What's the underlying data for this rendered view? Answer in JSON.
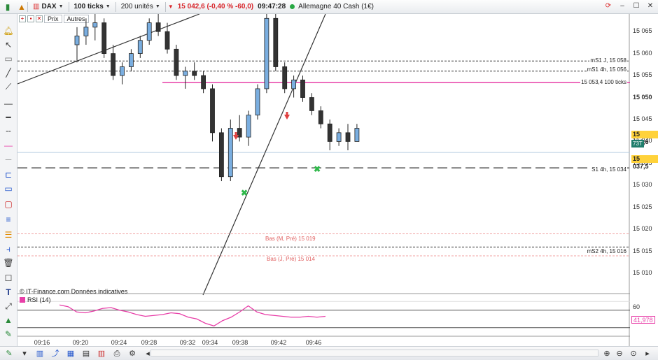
{
  "toolbar": {
    "symbol": "DAX",
    "ticks": "100 ticks",
    "units": "200 unités",
    "price_change": "15 042,6 (-0,40 % -60,0)",
    "time": "09:47:28",
    "instrument": "Allemagne 40 Cash (1€)",
    "colors": {
      "negative": "#d8262b",
      "live": "#27a843"
    }
  },
  "subbar": {
    "prix": "Prix",
    "autres": "Autres"
  },
  "price_axis": {
    "labels": [
      "15 065",
      "15 060",
      "15 055",
      "15 050",
      "15 045",
      "15 040",
      "15 035",
      "15 030",
      "15 025",
      "15 020",
      "15 015",
      "15 010"
    ],
    "current_price": "15 042,6",
    "ticks_left": "73T",
    "crosshair": "15 037,5"
  },
  "levels": {
    "ms1_j": "mS1 J, 15 058",
    "ms1_4h": "mS1 4h, 15 056",
    "ticks100": "15 053,4 100 ticks",
    "s1_4h": "S1 4h, 15 034",
    "bas_m": "Bas (M, Pré) 15 019",
    "bas_j": "Bas (J, Pré) 15 014",
    "ms2_4h": "mS2 4h, 15 016"
  },
  "footer_note": "© IT-Finance.com  Données indicatives",
  "rsi": {
    "label": "RSI (14)",
    "level": "60",
    "value": "41,978",
    "color": "#e83fa8"
  },
  "x_axis": [
    "09:16",
    "09:20",
    "09:24",
    "09:28",
    "09:32",
    "09:34",
    "09:38",
    "09:42",
    "09:46"
  ],
  "chart_data": {
    "type": "candlestick",
    "ylim": [
      15007,
      15069
    ],
    "candles": [
      {
        "o": 15062,
        "h": 15066,
        "l": 15058,
        "c": 15064
      },
      {
        "o": 15064,
        "h": 15068,
        "l": 15062,
        "c": 15066
      },
      {
        "o": 15066,
        "h": 15069,
        "l": 15063,
        "c": 15067
      },
      {
        "o": 15067,
        "h": 15068,
        "l": 15059,
        "c": 15060
      },
      {
        "o": 15060,
        "h": 15062,
        "l": 15054,
        "c": 15055
      },
      {
        "o": 15055,
        "h": 15058,
        "l": 15053,
        "c": 15057
      },
      {
        "o": 15057,
        "h": 15061,
        "l": 15056,
        "c": 15060
      },
      {
        "o": 15060,
        "h": 15064,
        "l": 15059,
        "c": 15063
      },
      {
        "o": 15063,
        "h": 15068,
        "l": 15062,
        "c": 15067
      },
      {
        "o": 15067,
        "h": 15069,
        "l": 15064,
        "c": 15065
      },
      {
        "o": 15065,
        "h": 15067,
        "l": 15060,
        "c": 15061
      },
      {
        "o": 15061,
        "h": 15062,
        "l": 15054,
        "c": 15055
      },
      {
        "o": 15055,
        "h": 15057,
        "l": 15052,
        "c": 15056
      },
      {
        "o": 15056,
        "h": 15058,
        "l": 15054,
        "c": 15055
      },
      {
        "o": 15055,
        "h": 15056,
        "l": 15051,
        "c": 15052
      },
      {
        "o": 15052,
        "h": 15053,
        "l": 15040,
        "c": 15042
      },
      {
        "o": 15042,
        "h": 15043,
        "l": 15031,
        "c": 15032
      },
      {
        "o": 15032,
        "h": 15045,
        "l": 15031,
        "c": 15043
      },
      {
        "o": 15043,
        "h": 15046,
        "l": 15040,
        "c": 15041
      },
      {
        "o": 15041,
        "h": 15047,
        "l": 15039,
        "c": 15046
      },
      {
        "o": 15046,
        "h": 15053,
        "l": 15045,
        "c": 15052
      },
      {
        "o": 15052,
        "h": 15069,
        "l": 15051,
        "c": 15068
      },
      {
        "o": 15068,
        "h": 15069,
        "l": 15056,
        "c": 15057
      },
      {
        "o": 15057,
        "h": 15058,
        "l": 15051,
        "c": 15052
      },
      {
        "o": 15052,
        "h": 15055,
        "l": 15050,
        "c": 15054
      },
      {
        "o": 15054,
        "h": 15055,
        "l": 15049,
        "c": 15050
      },
      {
        "o": 15050,
        "h": 15051,
        "l": 15046,
        "c": 15047
      },
      {
        "o": 15047,
        "h": 15048,
        "l": 15043,
        "c": 15044
      },
      {
        "o": 15044,
        "h": 15045,
        "l": 15038,
        "c": 15040
      },
      {
        "o": 15040,
        "h": 15043,
        "l": 15039,
        "c": 15042
      },
      {
        "o": 15042,
        "h": 15044,
        "l": 15038,
        "c": 15040
      },
      {
        "o": 15040,
        "h": 15044,
        "l": 15040,
        "c": 15043
      }
    ],
    "rsi_values": [
      66,
      64,
      58,
      57,
      59,
      62,
      63,
      60,
      58,
      55,
      53,
      54,
      55,
      57,
      56,
      52,
      50,
      45,
      42,
      48,
      52,
      58,
      65,
      58,
      55,
      54,
      53,
      52,
      52,
      53,
      52,
      53
    ]
  }
}
